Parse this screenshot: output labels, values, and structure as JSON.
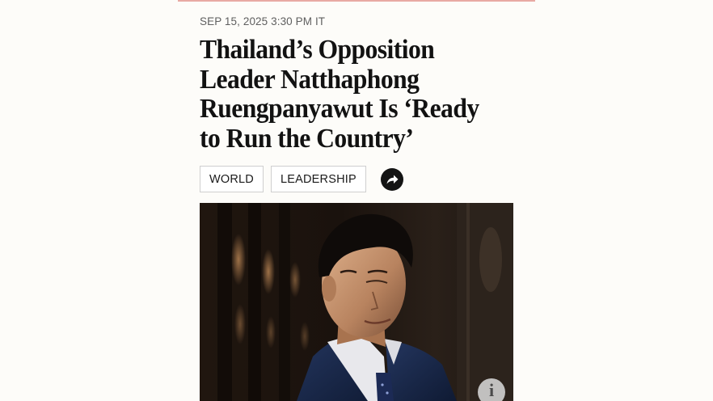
{
  "article": {
    "dateline": "SEP 15, 2025 3:30 PM IT",
    "headline": "Thailand’s Opposition Leader Natthaphong Ruengpanyawut Is ‘Ready to Run the Country’",
    "tags": [
      "WORLD",
      "LEADERSHIP"
    ]
  },
  "icons": {
    "share": "share-arrow-icon",
    "info": "info-icon"
  },
  "photo": {
    "info_label": "i"
  },
  "colors": {
    "background": "#fdfcf9",
    "accent_rule": "#e8a9a3",
    "headline": "#121212",
    "tag_border": "#cfcfcf"
  }
}
